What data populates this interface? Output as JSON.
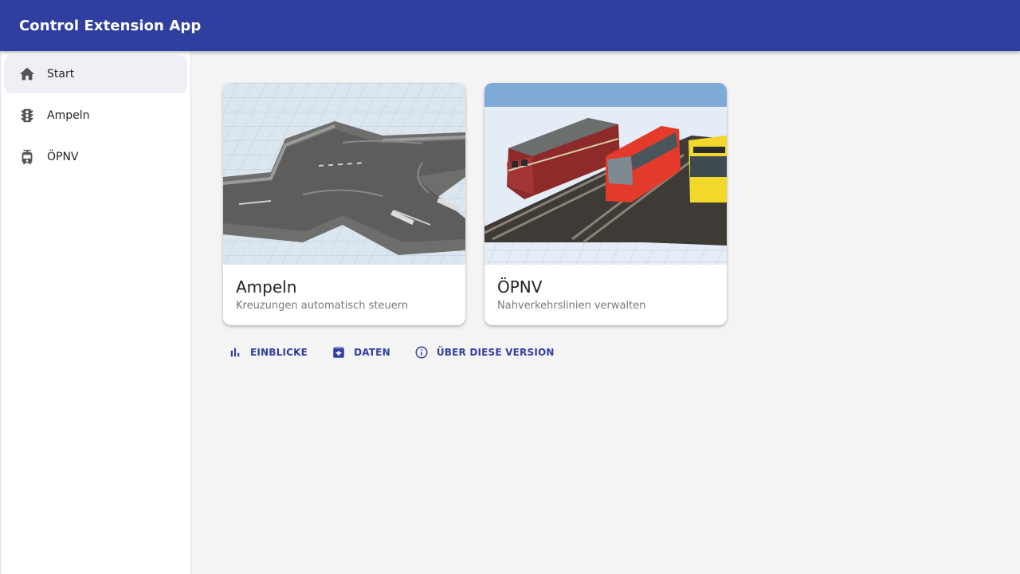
{
  "app": {
    "title": "Control Extension App"
  },
  "sidebar": {
    "items": [
      {
        "label": "Start",
        "icon": "home-icon",
        "active": true
      },
      {
        "label": "Ampeln",
        "icon": "traffic-light-icon",
        "active": false
      },
      {
        "label": "ÖPNV",
        "icon": "tram-icon",
        "active": false
      }
    ]
  },
  "cards": [
    {
      "title": "Ampeln",
      "subtitle": "Kreuzungen automatisch steuern",
      "image": "road-intersection-image"
    },
    {
      "title": "ÖPNV",
      "subtitle": "Nahverkehrslinien verwalten",
      "image": "trains-tram-bus-image"
    }
  ],
  "actions": [
    {
      "label": "EINBLICKE",
      "icon": "bar-chart-icon"
    },
    {
      "label": "DATEN",
      "icon": "archive-icon"
    },
    {
      "label": "ÜBER DIESE VERSION",
      "icon": "info-icon"
    }
  ],
  "colors": {
    "primary": "#303f9f",
    "background": "#f4f4f4",
    "active_nav": "#efeff5"
  }
}
